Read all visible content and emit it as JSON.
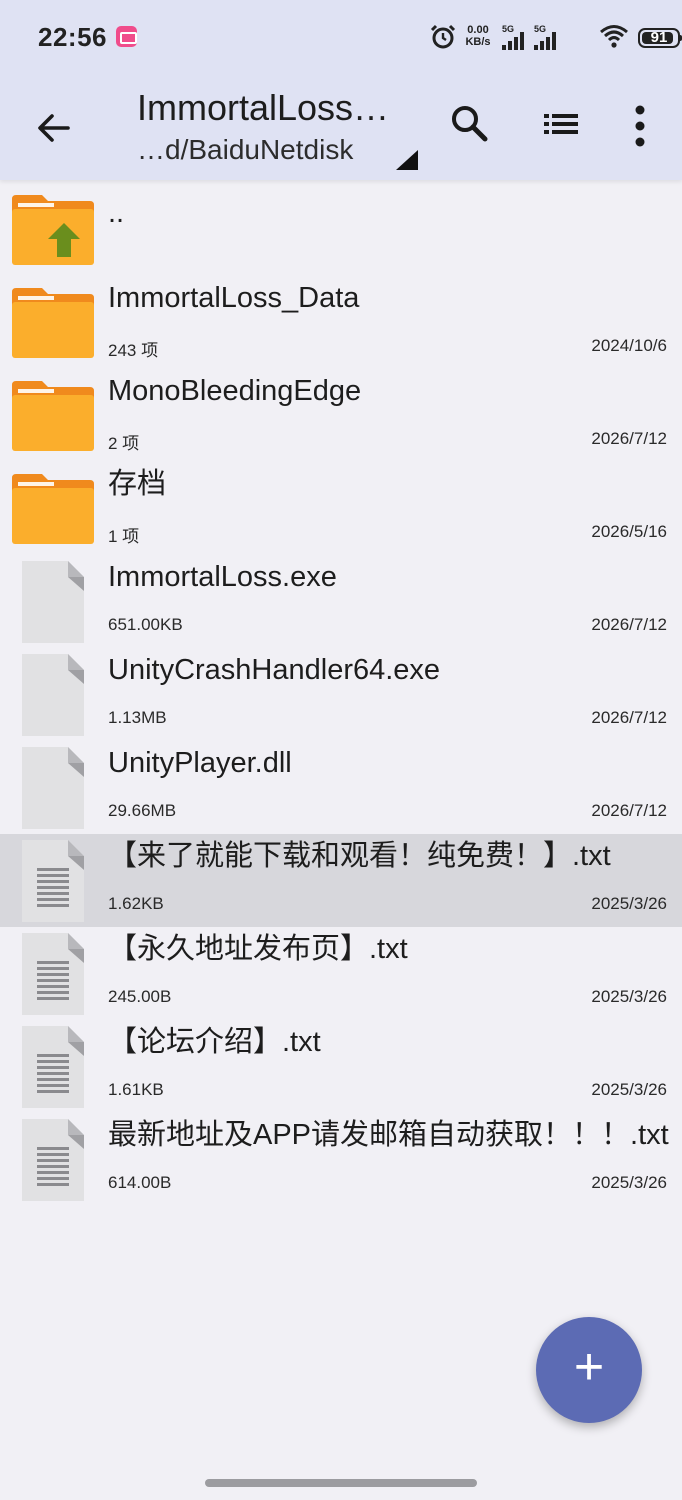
{
  "status_bar": {
    "time": "22:56",
    "net_speed_value": "0.00",
    "net_speed_unit": "KB/s",
    "signal1_label": "5G",
    "signal2_label": "5G",
    "battery": "91",
    "battery_level_percent": 91
  },
  "toolbar": {
    "title": "ImmortalLoss…",
    "path": "…d/BaiduNetdisk"
  },
  "files": [
    {
      "type": "parent",
      "name": "..",
      "meta": "",
      "date": ""
    },
    {
      "type": "folder",
      "name": "ImmortalLoss_Data",
      "meta": "243 项",
      "date": "2024/10/6"
    },
    {
      "type": "folder",
      "name": "MonoBleedingEdge",
      "meta": "2 项",
      "date": "2026/7/12"
    },
    {
      "type": "folder",
      "name": "存档",
      "meta": "1 项",
      "date": "2026/5/16"
    },
    {
      "type": "file",
      "name": "ImmortalLoss.exe",
      "meta": "651.00KB",
      "date": "2026/7/12"
    },
    {
      "type": "file",
      "name": "UnityCrashHandler64.exe",
      "meta": "1.13MB",
      "date": "2026/7/12"
    },
    {
      "type": "file",
      "name": "UnityPlayer.dll",
      "meta": "29.66MB",
      "date": "2026/7/12"
    },
    {
      "type": "text",
      "name": "【来了就能下载和观看！纯免费！】.txt",
      "meta": "1.62KB",
      "date": "2025/3/26",
      "selected": true
    },
    {
      "type": "text",
      "name": "【永久地址发布页】.txt",
      "meta": "245.00B",
      "date": "2025/3/26"
    },
    {
      "type": "text",
      "name": "【论坛介绍】.txt",
      "meta": "1.61KB",
      "date": "2025/3/26"
    },
    {
      "type": "text",
      "name": "最新地址及APP请发邮箱自动获取！！！.txt",
      "meta": "614.00B",
      "date": "2025/3/26"
    }
  ],
  "fab_label": "+",
  "colors": {
    "header_bg": "#dfe2f3",
    "folder": "#fbae2c",
    "folder_tab": "#f08a1d",
    "up_arrow": "#6a8e1d",
    "fab": "#5c6bb4",
    "file_icon": "#e1e1e3"
  },
  "icons": {
    "back": "arrow-left-icon",
    "search": "search-icon",
    "list": "list-view-icon",
    "more": "more-vert-icon",
    "fab": "plus-icon"
  }
}
